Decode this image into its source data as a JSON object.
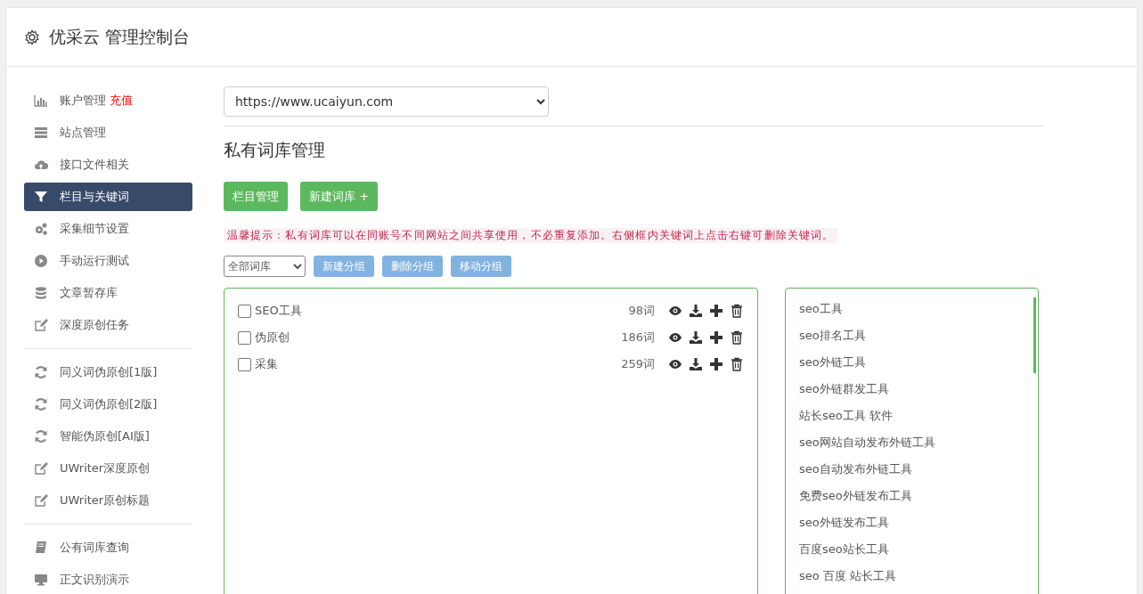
{
  "header": {
    "title": "优采云 管理控制台"
  },
  "sidebar": {
    "groups": [
      {
        "items": [
          {
            "label": "账户管理",
            "kind": "chart",
            "badge": "充值",
            "selected": false
          },
          {
            "label": "站点管理",
            "kind": "server",
            "selected": false
          },
          {
            "label": "接口文件相关",
            "kind": "cloud",
            "selected": false
          },
          {
            "label": "栏目与关键词",
            "kind": "filter",
            "selected": true
          },
          {
            "label": "采集细节设置",
            "kind": "gears",
            "selected": false
          },
          {
            "label": "手动运行测试",
            "kind": "play",
            "selected": false
          },
          {
            "label": "文章暂存库",
            "kind": "database",
            "selected": false
          },
          {
            "label": "深度原创任务",
            "kind": "edit",
            "selected": false
          }
        ]
      },
      {
        "items": [
          {
            "label": "同义词伪原创[1版]",
            "kind": "refresh",
            "selected": false
          },
          {
            "label": "同义词伪原创[2版]",
            "kind": "refresh",
            "selected": false
          },
          {
            "label": "智能伪原创[AI版]",
            "kind": "refresh",
            "selected": false
          },
          {
            "label": "UWriter深度原创",
            "kind": "edit",
            "selected": false
          },
          {
            "label": "UWriter原创标题",
            "kind": "edit",
            "selected": false
          }
        ]
      },
      {
        "items": [
          {
            "label": "公有词库查询",
            "kind": "book",
            "selected": false
          },
          {
            "label": "正文识别演示",
            "kind": "monitor",
            "selected": false
          }
        ]
      }
    ]
  },
  "site_select": {
    "value": "https://www.ucaiyun.com"
  },
  "page_title": "私有词库管理",
  "actions": [
    "栏目管理",
    "新建词库 +"
  ],
  "tip": "温馨提示：私有词库可以在同账号不同网站之间共享使用，不必重复添加。右侧框内关键词上点击右键可删除关键词。",
  "filter_select": {
    "value": "全部词库"
  },
  "group_buttons": [
    "新建分组",
    "删除分组",
    "移动分组"
  ],
  "libraries": [
    {
      "name": "SEO工具",
      "count": "98词",
      "checked": false
    },
    {
      "name": "伪原创",
      "count": "186词",
      "checked": false
    },
    {
      "name": "采集",
      "count": "259词",
      "checked": false
    }
  ],
  "keywords": [
    "seo工具",
    "seo排名工具",
    "seo外链工具",
    "seo外链群发工具",
    "站长seo工具 软件",
    "seo网站自动发布外链工具",
    "seo自动发布外链工具",
    "免费seo外链发布工具",
    "seo外链发布工具",
    "百度seo站长工具",
    "seo 百度 站长工具"
  ]
}
